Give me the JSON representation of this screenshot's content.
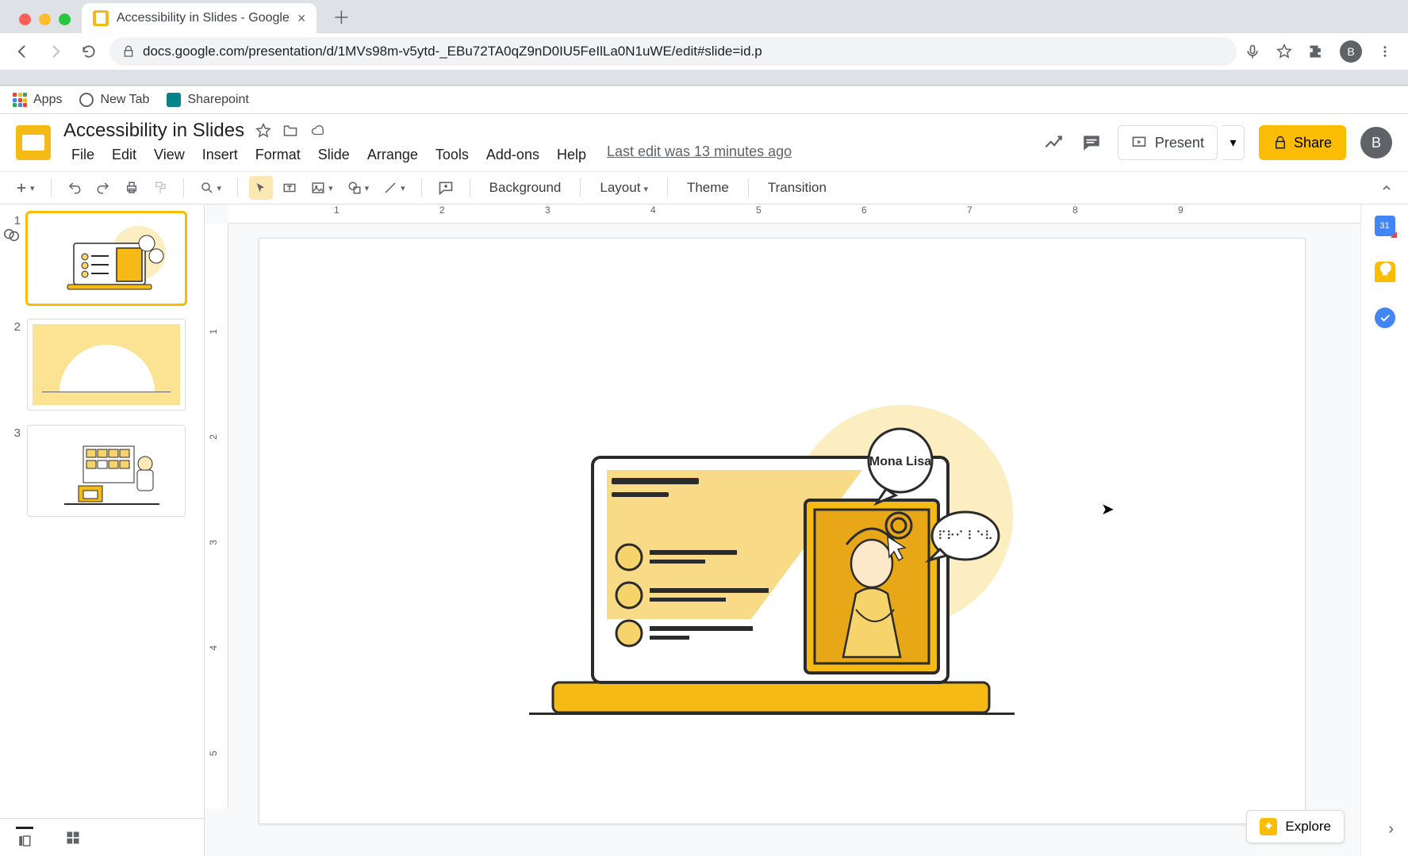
{
  "browser": {
    "tabTitle": "Accessibility in Slides - Google",
    "url": "docs.google.com/presentation/d/1MVs98m-v5ytd-_EBu72TA0qZ9nD0IU5FeIlLa0N1uWE/edit#slide=id.p",
    "bookmarks": {
      "apps": "Apps",
      "newTab": "New Tab",
      "sharepoint": "Sharepoint"
    },
    "profileInitial": "B"
  },
  "app": {
    "docTitle": "Accessibility in Slides",
    "menus": [
      "File",
      "Edit",
      "View",
      "Insert",
      "Format",
      "Slide",
      "Arrange",
      "Tools",
      "Add-ons",
      "Help"
    ],
    "lastEdit": "Last edit was 13 minutes ago",
    "present": "Present",
    "share": "Share",
    "avatarInitial": "B"
  },
  "toolbar": {
    "background": "Background",
    "layout": "Layout",
    "theme": "Theme",
    "transition": "Transition"
  },
  "filmstrip": {
    "slides": [
      {
        "num": "1",
        "selected": true
      },
      {
        "num": "2",
        "selected": false
      },
      {
        "num": "3",
        "selected": false
      }
    ]
  },
  "ruler": {
    "h": [
      "1",
      "2",
      "3",
      "4",
      "5",
      "6",
      "7",
      "8",
      "9"
    ],
    "v": [
      "1",
      "2",
      "3",
      "4",
      "5"
    ]
  },
  "canvas": {
    "speechLabel": "Mona Lisa",
    "brailleDots": "⠏⠗⠊ ⠇⠑⠧"
  },
  "explore": "Explore",
  "sidePanel": {
    "calendar": "31"
  }
}
